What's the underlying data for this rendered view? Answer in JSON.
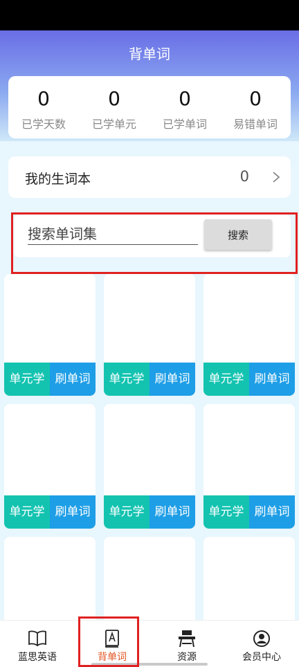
{
  "header": {
    "title": "背单词"
  },
  "stats": [
    {
      "value": "0",
      "label": "已学天数"
    },
    {
      "value": "0",
      "label": "已学单元"
    },
    {
      "value": "0",
      "label": "已学单词"
    },
    {
      "value": "0",
      "label": "易错单词"
    }
  ],
  "notebook": {
    "label": "我的生词本",
    "count": "0"
  },
  "search": {
    "placeholder": "搜索单词集",
    "button": "搜索"
  },
  "tiles": [
    {
      "learn": "单元学",
      "drill": "刷单词"
    },
    {
      "learn": "单元学",
      "drill": "刷单词"
    },
    {
      "learn": "单元学",
      "drill": "刷单词"
    },
    {
      "learn": "单元学",
      "drill": "刷单词"
    },
    {
      "learn": "单元学",
      "drill": "刷单词"
    },
    {
      "learn": "单元学",
      "drill": "刷单词"
    }
  ],
  "nav": [
    {
      "label": "蓝思英语",
      "icon": "book-open-icon"
    },
    {
      "label": "背单词",
      "icon": "vocabulary-book-icon"
    },
    {
      "label": "资源",
      "icon": "desk-icon"
    },
    {
      "label": "会员中心",
      "icon": "user-circle-icon"
    }
  ],
  "colors": {
    "header": "#6a6ee6",
    "learn_button": "#13c3b0",
    "drill_button": "#1e9ee6",
    "active_nav": "#e0531f",
    "highlight": "#e02020"
  }
}
